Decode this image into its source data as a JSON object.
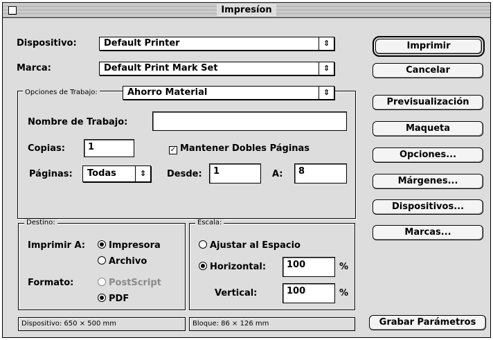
{
  "window": {
    "title": "Impresíon"
  },
  "device": {
    "label": "Dispositivo:",
    "value": "Default Printer"
  },
  "mark": {
    "label": "Marca:",
    "value": "Default Print Mark Set"
  },
  "job_options": {
    "group_label": "Opciones de Trabajo:",
    "preset_value": "Ahorro Material",
    "job_name_label": "Nombre de Trabajo:",
    "job_name_value": "",
    "copies_label": "Copias:",
    "copies_value": "1",
    "keep_double_pages_label": "Mantener Dobles Páginas",
    "keep_double_pages_checked": true,
    "pages_label": "Páginas:",
    "pages_value": "Todas",
    "from_label": "Desde:",
    "from_value": "1",
    "to_label": "A:",
    "to_value": "8"
  },
  "destination": {
    "group_label": "Destino:",
    "print_to_label": "Imprimir A:",
    "printer_option": "Impresora",
    "file_option": "Archivo",
    "format_label": "Formato:",
    "postscript_option": "PostScript",
    "pdf_option": "PDF"
  },
  "scale": {
    "group_label": "Escala:",
    "fit_option": "Ajustar al Espacio",
    "horizontal_label": "Horizontal:",
    "horizontal_value": "100",
    "vertical_label": "Vertical:",
    "vertical_value": "100",
    "percent": "%"
  },
  "buttons": {
    "print": "Imprimir",
    "cancel": "Cancelar",
    "preview": "Previsualización",
    "layout": "Maqueta",
    "options": "Opciones...",
    "margins": "Márgenes...",
    "devices": "Dispositivos...",
    "marks": "Marcas...",
    "save_params": "Grabar Parámetros"
  },
  "status": {
    "device_info": "Dispositivo: 650 × 500 mm",
    "block_info": "Bloque: 86 × 126 mm"
  },
  "icons": {
    "popup_arrows": "⇕",
    "check_mark": "✓"
  }
}
